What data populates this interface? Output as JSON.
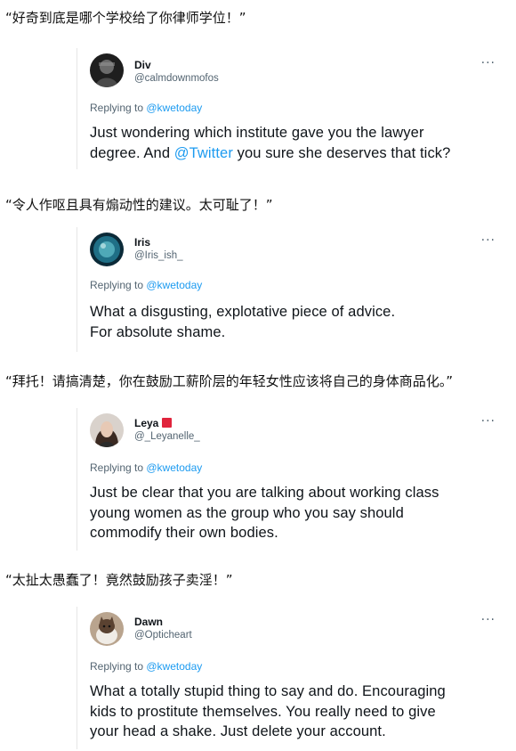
{
  "posts": [
    {
      "quote": "“好奇到底是哪个学校给了你律师学位！”",
      "name": "Div",
      "handle": "@calmdownmofos",
      "replying_prefix": "Replying to ",
      "replying_to": "@kwetoday",
      "body_lines": [
        {
          "before": "Just wondering which institute gave you the lawyer",
          "mention": "",
          "after": ""
        },
        {
          "before": "degree. And ",
          "mention": "@Twitter",
          "after": " you sure she deserves that tick?"
        }
      ],
      "more": "···",
      "avatar_color": "#2b2b2b"
    },
    {
      "quote": "“令人作呕且具有煽动性的建议。太可耻了！”",
      "name": "Iris",
      "handle": "@Iris_ish_",
      "replying_prefix": "Replying to ",
      "replying_to": "@kwetoday",
      "body_lines": [
        {
          "before": "What a disgusting, explotative piece of advice.",
          "mention": "",
          "after": ""
        },
        {
          "before": "For absolute shame.",
          "mention": "",
          "after": ""
        }
      ],
      "more": "···",
      "avatar_color": "#1c5a73"
    },
    {
      "quote": "“拜托！请搞清楚，你在鼓励工薪阶层的年轻女性应该将自己的身体商品化。”",
      "name": "Leya",
      "handle": "@_Leyanelle_",
      "replying_prefix": "Replying to ",
      "replying_to": "@kwetoday",
      "body_lines": [
        {
          "before": "Just be clear that you are talking about working class",
          "mention": "",
          "after": ""
        },
        {
          "before": "young women as the group who you say should",
          "mention": "",
          "after": ""
        },
        {
          "before": "commodify their own bodies.",
          "mention": "",
          "after": ""
        }
      ],
      "more": "···",
      "avatar_color": "#7a6a60"
    },
    {
      "quote": "“太扯太愚蠢了！竟然鼓励孩子卖淫！”",
      "name": "Dawn",
      "handle": "@Opticheart",
      "replying_prefix": "Replying to ",
      "replying_to": "@kwetoday",
      "body_lines": [
        {
          "before": "What a totally stupid thing to say and do. Encouraging",
          "mention": "",
          "after": ""
        },
        {
          "before": "kids to prostitute themselves.  You really need to give",
          "mention": "",
          "after": ""
        },
        {
          "before": "your head a shake.  Just delete your account.",
          "mention": "",
          "after": ""
        }
      ],
      "more": "···",
      "avatar_color": "#8a6f55"
    }
  ]
}
